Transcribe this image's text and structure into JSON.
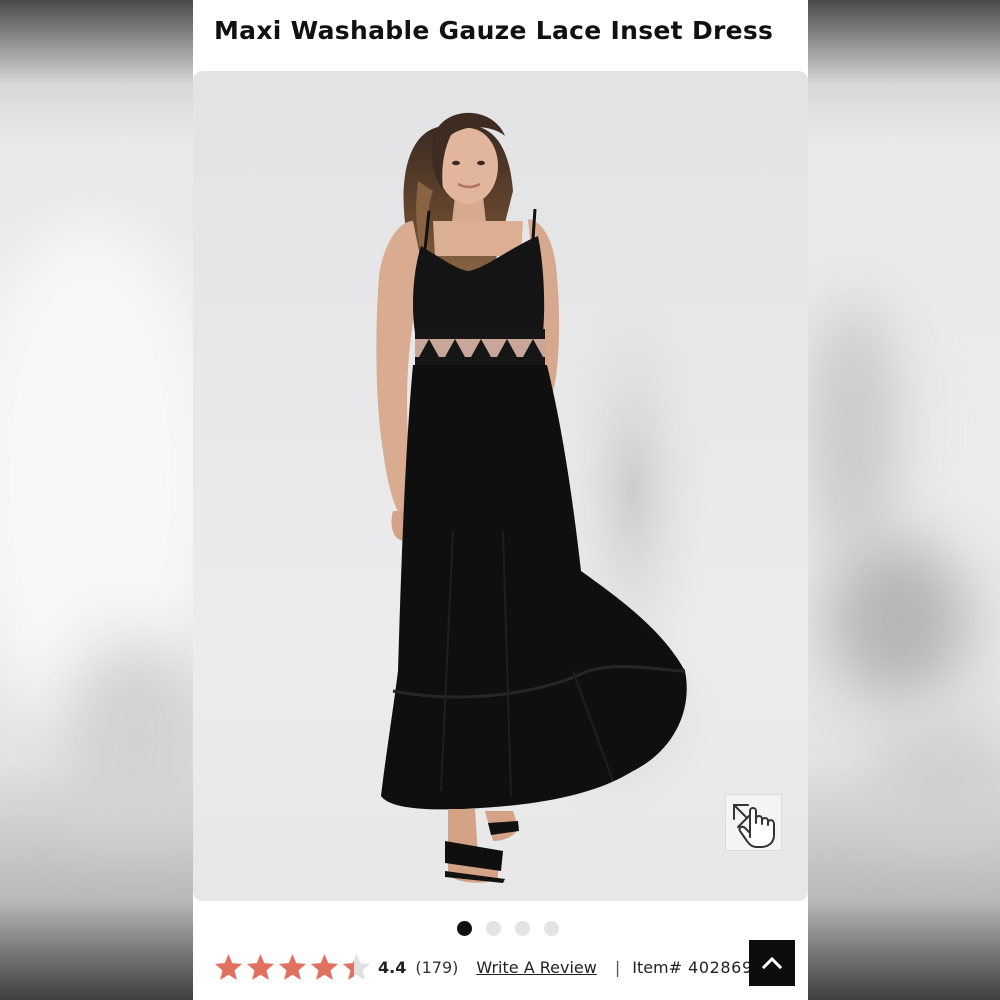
{
  "product": {
    "title": "Maxi Washable Gauze Lace Inset Dress"
  },
  "gallery": {
    "image_alt": "Model wearing black maxi dress with lace inset",
    "zoom_icon": "tap-to-zoom-icon",
    "dots_total": 4,
    "active_dot": 1
  },
  "rating": {
    "value": "4.4",
    "stars": 4.4,
    "count": "(179)",
    "write_review": "Write A Review",
    "separator": "|",
    "item_label": "Item#",
    "item_number": "402869"
  },
  "colors": {
    "star": "#e07160",
    "star_empty": "#e0e0e0",
    "back_to_top": "#0d0d0d"
  },
  "icons": {
    "back_to_top": "chevron-up-icon"
  }
}
